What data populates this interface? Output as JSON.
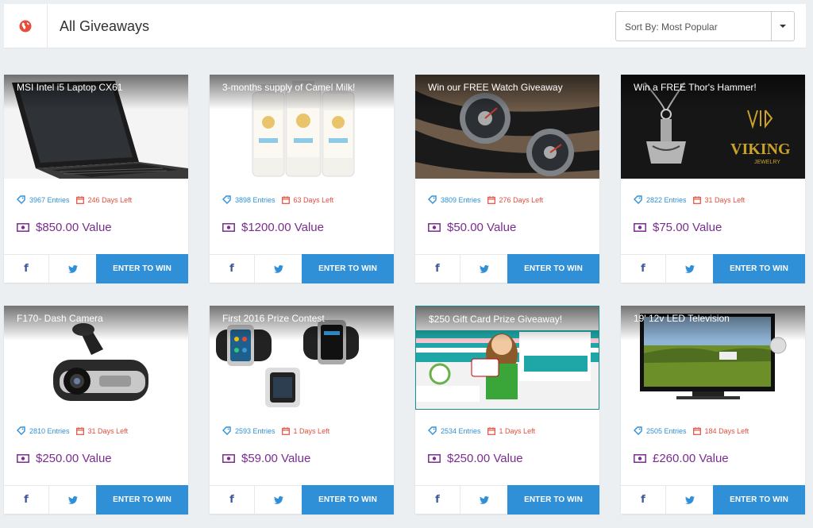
{
  "header": {
    "title": "All Giveaways",
    "sort_label": "Sort By: Most Popular",
    "icon": "globe-icon"
  },
  "colors": {
    "accent_blue": "#2f90d8",
    "days_red": "#e74c3c",
    "value_purple": "#7a2d8f",
    "globe_red": "#e74c3c"
  },
  "giveaways": [
    {
      "title": "MSI Intel i5 Laptop CX61",
      "entries": "3967 Entries",
      "days_left": "246 Days Left",
      "value": "$850.00 Value",
      "enter_label": "ENTER TO WIN",
      "image": "laptop"
    },
    {
      "title": "3-months supply of Camel Milk!",
      "entries": "3898 Entries",
      "days_left": "63 Days Left",
      "value": "$1200.00 Value",
      "enter_label": "ENTER TO WIN",
      "image": "camel-milk-bottles"
    },
    {
      "title": "Win our FREE Watch Giveaway",
      "entries": "3809 Entries",
      "days_left": "276 Days Left",
      "value": "$50.00 Value",
      "enter_label": "ENTER TO WIN",
      "image": "watches"
    },
    {
      "title": "Win a FREE Thor's Hammer!",
      "entries": "2822 Entries",
      "days_left": "31 Days Left",
      "value": "$75.00 Value",
      "enter_label": "ENTER TO WIN",
      "image": "viking-pendant",
      "logo_text": "VIKING",
      "logo_subtext": "JEWELRY"
    },
    {
      "title": "F170- Dash Camera",
      "entries": "2810 Entries",
      "days_left": "31 Days Left",
      "value": "$250.00 Value",
      "enter_label": "ENTER TO WIN",
      "image": "dash-camera"
    },
    {
      "title": "First 2016 Prize Contest",
      "entries": "2593 Entries",
      "days_left": "1 Days Left",
      "value": "$59.00 Value",
      "enter_label": "ENTER TO WIN",
      "image": "smartwatches"
    },
    {
      "title": "$250 Gift Card Prize Giveaway!",
      "entries": "2534 Entries",
      "days_left": "1 Days Left",
      "value": "$250.00 Value",
      "enter_label": "ENTER TO WIN",
      "image": "gift-card-promo"
    },
    {
      "title": "19' 12v LED Television",
      "entries": "2505 Entries",
      "days_left": "184 Days Left",
      "value": "£260.00 Value",
      "enter_label": "ENTER TO WIN",
      "image": "led-television"
    }
  ]
}
